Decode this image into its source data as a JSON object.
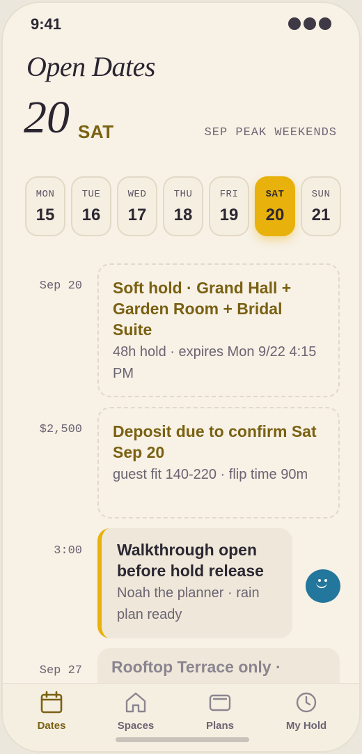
{
  "status": {
    "time": "9:41"
  },
  "header": {
    "title": "Open Dates",
    "selected_day": "20",
    "selected_dow": "SAT",
    "peak_label": "SEP PEAK WEEKENDS"
  },
  "dates": [
    {
      "dow": "MON",
      "num": "15"
    },
    {
      "dow": "TUE",
      "num": "16"
    },
    {
      "dow": "WED",
      "num": "17"
    },
    {
      "dow": "THU",
      "num": "18"
    },
    {
      "dow": "FRI",
      "num": "19"
    },
    {
      "dow": "SAT",
      "num": "20"
    },
    {
      "dow": "SUN",
      "num": "21"
    }
  ],
  "timeline": [
    {
      "label": "Sep 20",
      "title": "Soft hold · Grand Hall + Garden Room + Bridal Suite",
      "sub": "48h hold · expires Mon 9/22 4:15 PM"
    },
    {
      "label": "$2,500",
      "title": "Deposit due to confirm Sat Sep 20",
      "sub": "guest fit 140-220 · flip time 90m"
    },
    {
      "label": "3:00",
      "title": "Walkthrough open before hold release",
      "sub": "Noah the planner · rain plan ready"
    },
    {
      "label": "Sep 27",
      "title": "Rooftop Terrace only ·"
    }
  ],
  "tabs": [
    {
      "label": "Dates",
      "icon": "calendar-icon"
    },
    {
      "label": "Spaces",
      "icon": "home-icon"
    },
    {
      "label": "Plans",
      "icon": "wallet-icon"
    },
    {
      "label": "My Hold",
      "icon": "clock-icon"
    }
  ],
  "colors": {
    "accent": "#e8b10c",
    "accent_text": "#7a6112",
    "avatar": "#23769c"
  }
}
